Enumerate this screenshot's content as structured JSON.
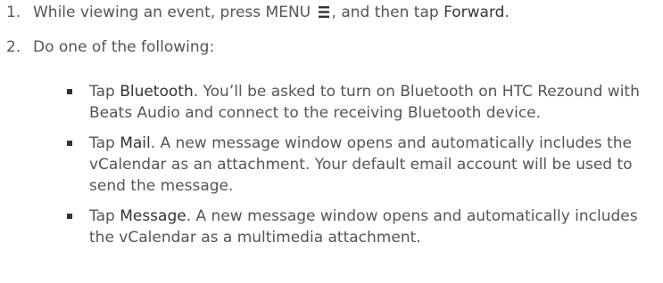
{
  "steps": [
    {
      "number": "1.",
      "before": "While viewing an event, press MENU",
      "icon": "menu-icon",
      "middle": ", and then tap ",
      "bold": "Forward",
      "after": "."
    },
    {
      "number": "2.",
      "text": "Do one of the following:"
    }
  ],
  "bullets": [
    {
      "prefix": "Tap ",
      "bold": "Bluetooth",
      "text": ". You’ll be asked to turn on Bluetooth on HTC Rezound with Beats Audio and connect to the receiving Bluetooth device."
    },
    {
      "prefix": "Tap ",
      "bold": "Mail",
      "text": ". A new message window opens and automatically includes the vCalendar as an attachment. Your default email account will be used to send the message."
    },
    {
      "prefix": "Tap ",
      "bold": "Message",
      "text": ". A new message window opens and automatically includes the vCalendar as a multimedia attachment."
    }
  ]
}
